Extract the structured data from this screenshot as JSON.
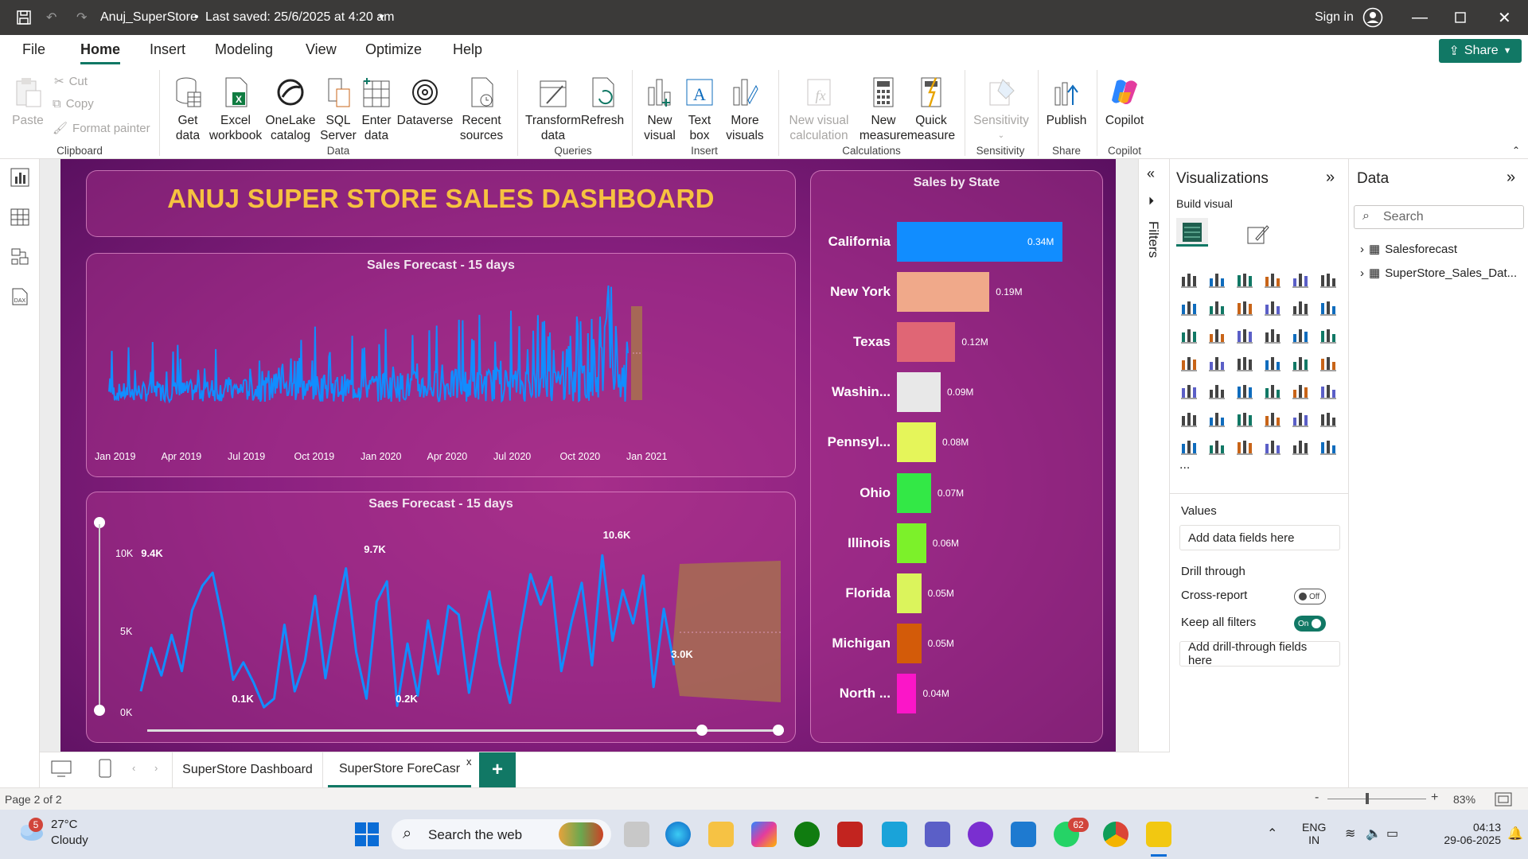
{
  "titlebar": {
    "doc_title": "Anuj_SuperStore",
    "saved_status": "Last saved: 25/6/2025 at 4:20 am",
    "sign_in": "Sign in"
  },
  "menu": {
    "items": [
      "File",
      "Home",
      "Insert",
      "Modeling",
      "View",
      "Optimize",
      "Help"
    ],
    "active": "Home",
    "share": "Share"
  },
  "ribbon": {
    "clipboard": {
      "paste": "Paste",
      "cut": "Cut",
      "copy": "Copy",
      "format_painter": "Format painter",
      "group": "Clipboard"
    },
    "data": {
      "get_data": [
        "Get",
        "data"
      ],
      "excel": [
        "Excel",
        "workbook"
      ],
      "onelake": [
        "OneLake",
        "catalog"
      ],
      "sql": [
        "SQL",
        "Server"
      ],
      "enter": [
        "Enter",
        "data"
      ],
      "dataverse": "Dataverse",
      "recent": [
        "Recent",
        "sources"
      ],
      "group": "Data"
    },
    "queries": {
      "transform": [
        "Transform",
        "data"
      ],
      "refresh": "Refresh",
      "group": "Queries"
    },
    "insert": {
      "new_visual": [
        "New",
        "visual"
      ],
      "text_box": [
        "Text",
        "box"
      ],
      "more_visuals": [
        "More",
        "visuals"
      ],
      "group": "Insert"
    },
    "calculations": {
      "new_visual_calc": [
        "New visual",
        "calculation"
      ],
      "new_measure": [
        "New",
        "measure"
      ],
      "quick_measure": [
        "Quick",
        "measure"
      ],
      "group": "Calculations"
    },
    "sensitivity": {
      "label": "Sensitivity",
      "group": "Sensitivity"
    },
    "share": {
      "publish": "Publish",
      "group": "Share"
    },
    "copilot": {
      "label": "Copilot",
      "group": "Copilot"
    }
  },
  "dashboard": {
    "title": "ANUJ SUPER STORE SALES DASHBOARD",
    "forecast1": {
      "title": "Sales Forecast - 15 days",
      "x_ticks": [
        "Jan 2019",
        "Apr 2019",
        "Jul 2019",
        "Oct 2019",
        "Jan 2020",
        "Apr 2020",
        "Jul 2020",
        "Oct 2020",
        "Jan 2021"
      ]
    },
    "forecast2": {
      "title": "Saes Forecast - 15 days",
      "y_ticks": [
        "10K",
        "5K",
        "0K"
      ],
      "labels": [
        "9.4K",
        "9.7K",
        "10.6K",
        "0.1K",
        "0.2K",
        "3.0K"
      ]
    },
    "states_title": "Sales by State"
  },
  "chart_data": [
    {
      "type": "line",
      "title": "Sales Forecast - 15 days",
      "x_range": [
        "Jan 2019",
        "Jan 2021"
      ],
      "note_series": "daily sales with forecast band"
    },
    {
      "type": "line",
      "title": "Saes Forecast - 15 days",
      "ylim": [
        0,
        11000
      ],
      "values": [
        1200,
        4200,
        2300,
        5100,
        2600,
        6800,
        8500,
        9400,
        6000,
        2000,
        3200,
        1800,
        100,
        700,
        5800,
        1200,
        3300,
        7800,
        2100,
        6200,
        9700,
        3900,
        700,
        7400,
        8800,
        200,
        4500,
        900,
        6100,
        2400,
        7100,
        6500,
        1100,
        5200,
        8100,
        3100,
        400,
        5300,
        9300,
        7200,
        9100,
        2600,
        6000,
        8700,
        3000,
        10600,
        4700,
        8200,
        5900,
        9200,
        1500,
        6900,
        3000
      ]
    },
    {
      "type": "bar",
      "title": "Sales by State",
      "categories": [
        "California",
        "New York",
        "Texas",
        "Washin...",
        "Pennsyl...",
        "Ohio",
        "Illinois",
        "Florida",
        "Michigan",
        "North ..."
      ],
      "values": [
        0.34,
        0.19,
        0.12,
        0.09,
        0.08,
        0.07,
        0.06,
        0.05,
        0.05,
        0.04
      ],
      "value_labels": [
        "0.34M",
        "0.19M",
        "0.12M",
        "0.09M",
        "0.08M",
        "0.07M",
        "0.06M",
        "0.05M",
        "0.05M",
        "0.04M"
      ],
      "colors": [
        "#118dff",
        "#f0a98a",
        "#e06675",
        "#e8e8e8",
        "#e5f55a",
        "#33e846",
        "#7cf12a",
        "#dbf45c",
        "#d35b09",
        "#fb16c8"
      ]
    }
  ],
  "filters_label": "Filters",
  "viz_pane": {
    "title": "Visualizations",
    "build_visual": "Build visual",
    "values": "Values",
    "add_data": "Add data fields here",
    "drill_through": "Drill through",
    "cross_report": "Cross-report",
    "cross_state": "Off",
    "keep_filters": "Keep all filters",
    "keep_state": "On",
    "add_drill": "Add drill-through fields here",
    "more": "..."
  },
  "data_pane": {
    "title": "Data",
    "search_placeholder": "Search",
    "tables": [
      "Salesforecast",
      "SuperStore_Sales_Dat..."
    ]
  },
  "tabs": {
    "pages": [
      "SuperStore Dashboard",
      "SuperStore ForeCasr"
    ],
    "active": 1,
    "close": "x",
    "add": "+"
  },
  "status": {
    "page": "Page 2 of 2",
    "zoom": "83%",
    "minus": "-",
    "plus": "+"
  },
  "taskbar": {
    "weather_temp": "27°C",
    "weather_desc": "Cloudy",
    "weather_badge": "5",
    "search": "Search the web",
    "whatsapp_badge": "62",
    "lang": [
      "ENG",
      "IN"
    ],
    "time": "04:13",
    "date": "29-06-2025"
  },
  "colors": {
    "accent": "#117865",
    "bar_blue": "#118dff",
    "title_gold": "#f6c240"
  }
}
